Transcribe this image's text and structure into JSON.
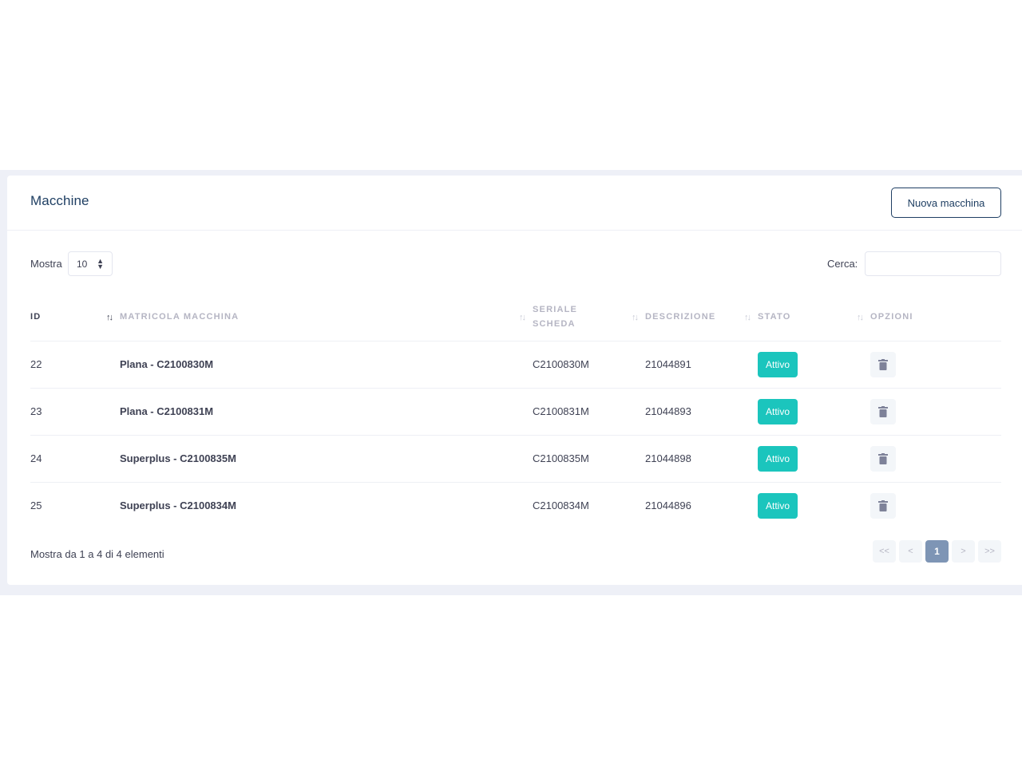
{
  "card": {
    "title": "Macchine",
    "new_button_label": "Nuova macchina"
  },
  "toolbar": {
    "length_label": "Mostra",
    "length_value": "10",
    "search_label": "Cerca:",
    "search_value": ""
  },
  "table": {
    "columns": [
      "ID",
      "MATRICOLA MACCHINA",
      "SERIALE SCHEDA",
      "DESCRIZIONE",
      "STATO",
      "OPZIONI"
    ],
    "sorted_column": "ID",
    "rows": [
      {
        "id": "22",
        "matricola": "Plana - C2100830M",
        "seriale": "C2100830M",
        "descrizione": "21044891",
        "stato": "Attivo"
      },
      {
        "id": "23",
        "matricola": "Plana - C2100831M",
        "seriale": "C2100831M",
        "descrizione": "21044893",
        "stato": "Attivo"
      },
      {
        "id": "24",
        "matricola": "Superplus - C2100835M",
        "seriale": "C2100835M",
        "descrizione": "21044898",
        "stato": "Attivo"
      },
      {
        "id": "25",
        "matricola": "Superplus - C2100834M",
        "seriale": "C2100834M",
        "descrizione": "21044896",
        "stato": "Attivo"
      }
    ]
  },
  "footer": {
    "info": "Mostra da 1 a 4 di 4 elementi",
    "pagination": {
      "first": "<<",
      "prev": "<",
      "current": "1",
      "next": ">",
      "last": ">>"
    }
  },
  "colors": {
    "accent": "#1f3f63",
    "status_active": "#1bc5bd",
    "page_active": "#7e95b5"
  },
  "icons": {
    "row_action": "trash-icon",
    "sort": "sort-arrows-icon"
  }
}
